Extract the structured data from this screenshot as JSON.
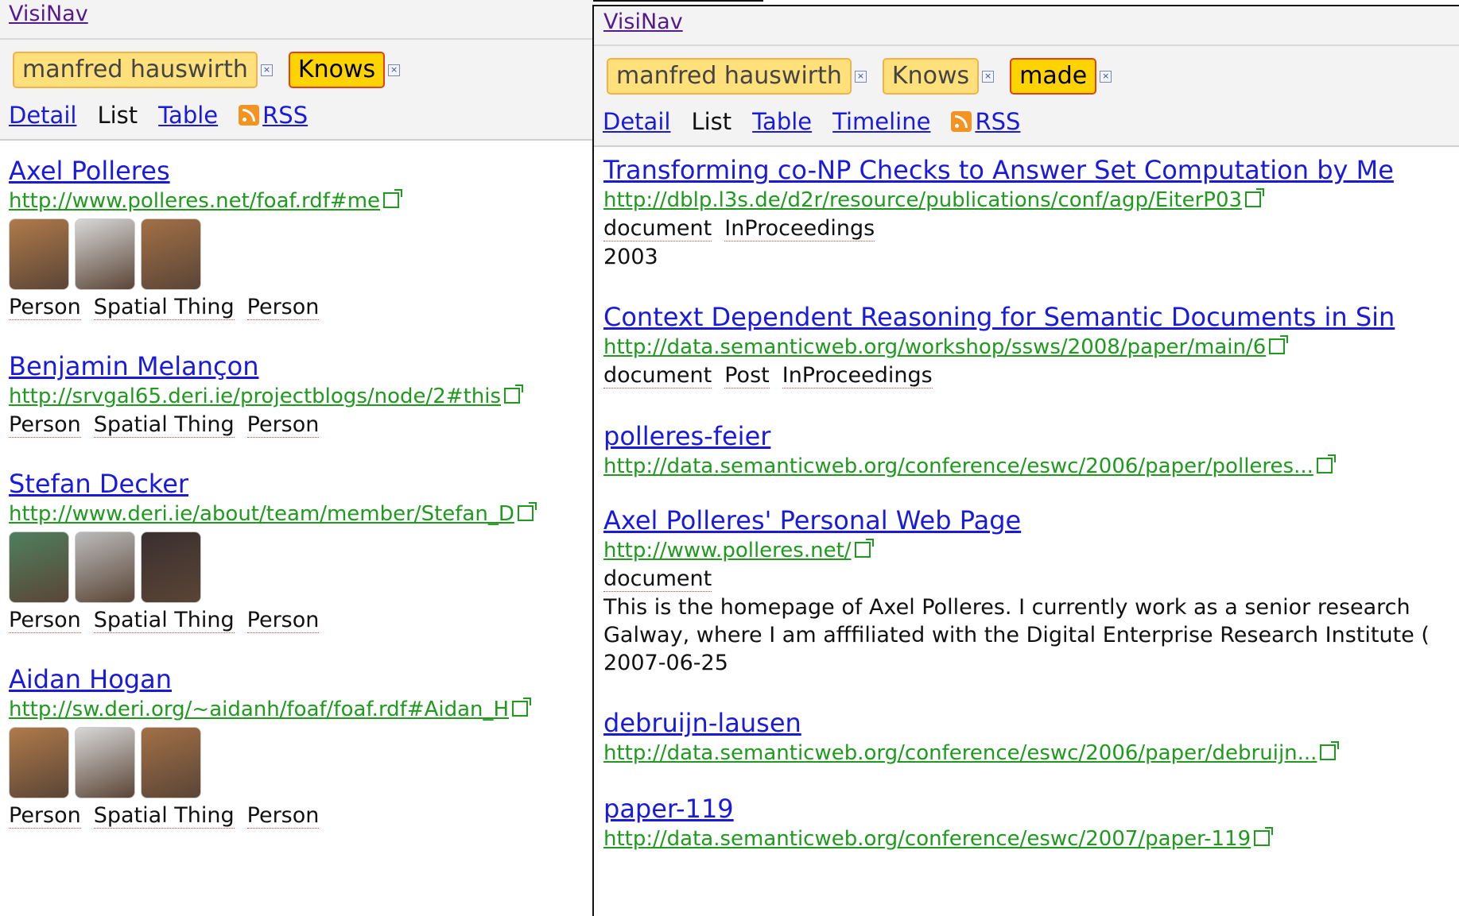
{
  "left": {
    "brand": "VisiNav",
    "facets": [
      {
        "label": "manfred hauswirth",
        "active": false
      },
      {
        "label": "Knows",
        "active": true
      }
    ],
    "tabs": [
      {
        "label": "Detail",
        "current": false
      },
      {
        "label": "List",
        "current": true
      },
      {
        "label": "Table",
        "current": false
      }
    ],
    "rss_label": "RSS",
    "results": [
      {
        "title": "Axel Polleres",
        "url": "http://www.polleres.net/foaf.rdf#me",
        "types": [
          "Person",
          "Spatial Thing",
          "Person"
        ],
        "photos": 3
      },
      {
        "title": "Benjamin Melançon",
        "url": "http://srvgal65.deri.ie/projectblogs/node/2#this",
        "types": [
          "Person",
          "Spatial Thing",
          "Person"
        ],
        "photos": 0
      },
      {
        "title": "Stefan Decker",
        "url": "http://www.deri.ie/about/team/member/Stefan_D",
        "types": [
          "Person",
          "Spatial Thing",
          "Person"
        ],
        "photos": 3
      },
      {
        "title": "Aidan Hogan",
        "url": "http://sw.deri.org/~aidanh/foaf/foaf.rdf#Aidan_H",
        "types": [
          "Person",
          "Spatial Thing",
          "Person"
        ],
        "photos": 3
      }
    ]
  },
  "right": {
    "brand": "VisiNav",
    "facets": [
      {
        "label": "manfred hauswirth",
        "active": false
      },
      {
        "label": "Knows",
        "active": false
      },
      {
        "label": "made",
        "active": true
      }
    ],
    "tabs": [
      {
        "label": "Detail",
        "current": false
      },
      {
        "label": "List",
        "current": true
      },
      {
        "label": "Table",
        "current": false
      },
      {
        "label": "Timeline",
        "current": false
      }
    ],
    "rss_label": "RSS",
    "results": [
      {
        "title": "Transforming co-NP Checks to Answer Set Computation by Me",
        "url": "http://dblp.l3s.de/d2r/resource/publications/conf/agp/EiterP03",
        "types": [
          "document",
          "InProceedings"
        ],
        "extra": [
          "2003"
        ]
      },
      {
        "title": "Context Dependent Reasoning for Semantic Documents in Sin",
        "url": "http://data.semanticweb.org/workshop/ssws/2008/paper/main/6",
        "types": [
          "document",
          "Post",
          "InProceedings"
        ],
        "extra": []
      },
      {
        "title": "polleres-feier",
        "url": "http://data.semanticweb.org/conference/eswc/2006/paper/polleres...",
        "types": [],
        "extra": []
      },
      {
        "title": "Axel Polleres' Personal Web Page",
        "url": "http://www.polleres.net/",
        "types": [
          "document"
        ],
        "extra": [
          "This is the homepage of Axel Polleres. I currently work as a senior research",
          "Galway, where I am afffiliated with the Digital Enterprise Research Institute (",
          "2007-06-25"
        ]
      },
      {
        "title": "debruijn-lausen",
        "url": "http://data.semanticweb.org/conference/eswc/2006/paper/debruijn...",
        "types": [],
        "extra": []
      },
      {
        "title": "paper-119",
        "url": "http://data.semanticweb.org/conference/eswc/2007/paper-119",
        "types": [],
        "extra": []
      }
    ]
  }
}
